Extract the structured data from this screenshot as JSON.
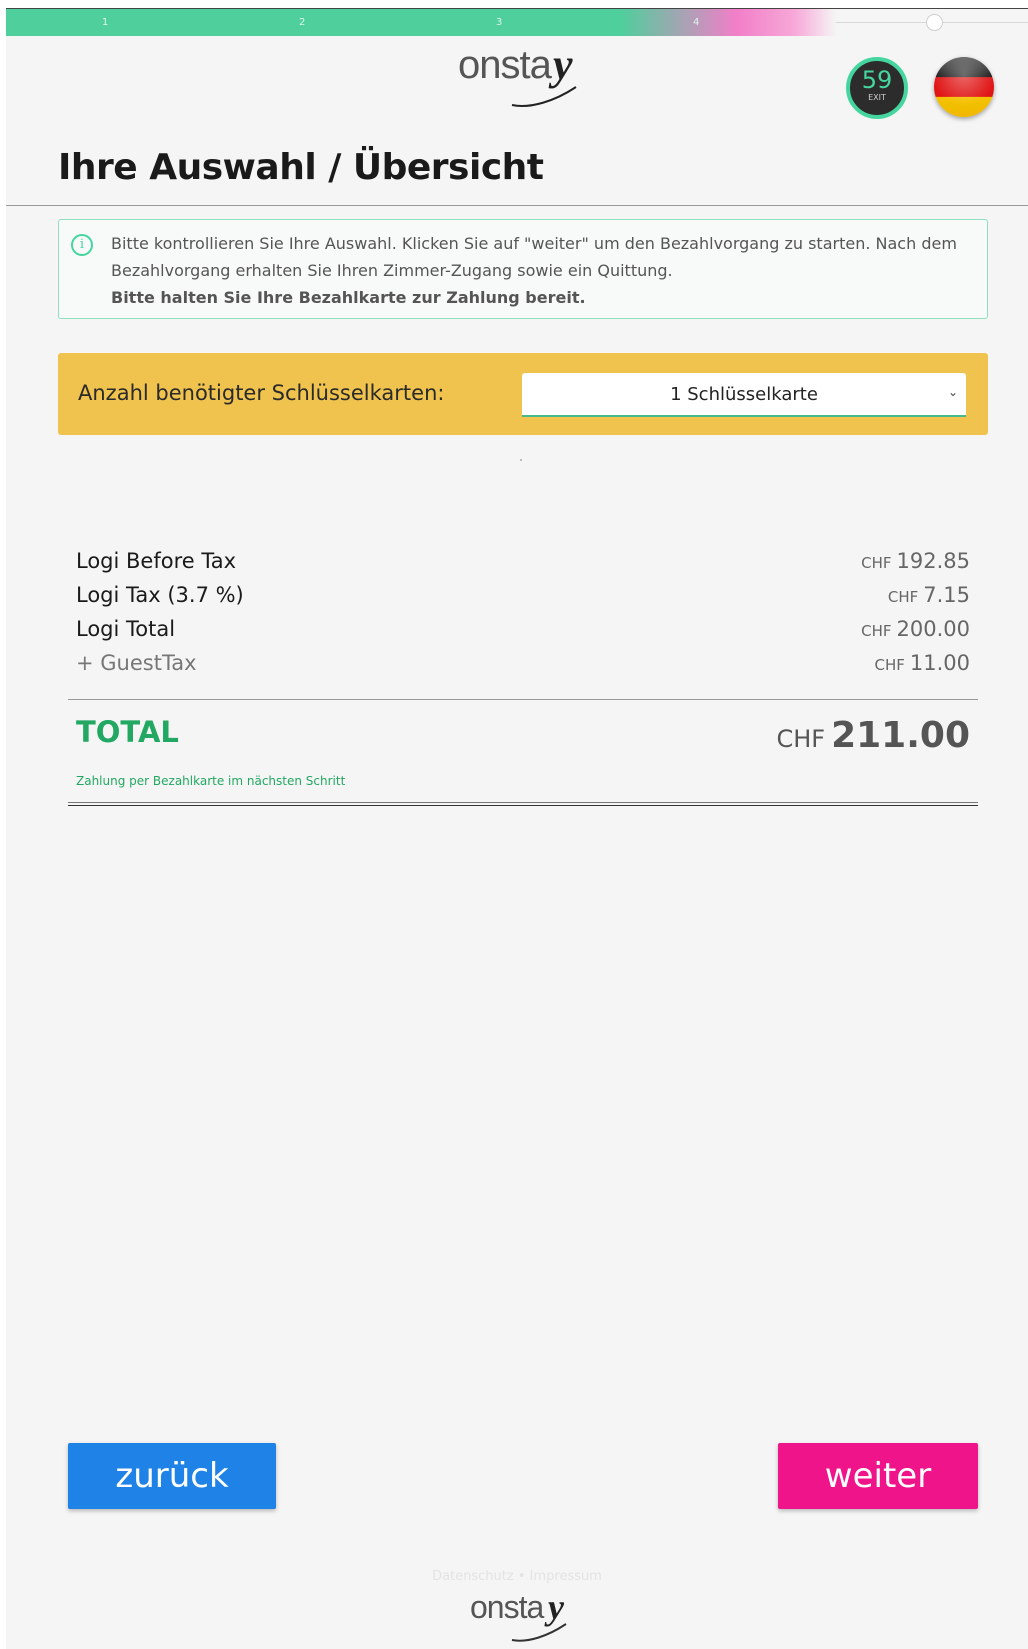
{
  "progress": {
    "steps": [
      "1",
      "2",
      "3",
      "4"
    ],
    "completed_fraction": 0.81
  },
  "header": {
    "logo_text": "onsta",
    "logo_mark": "y",
    "timer": {
      "seconds": "59",
      "label": "EXIT"
    },
    "language_flag": "germany-flag-icon"
  },
  "page_title": "Ihre Auswahl / Übersicht",
  "info": {
    "icon": "info-icon",
    "line1": "Bitte kontrollieren Sie Ihre Auswahl. Klicken Sie auf \"weiter\" um den Bezahlvorgang zu starten. Nach dem Bezahlvorgang erhalten Sie Ihren Zimmer-Zugang sowie ein Quittung.",
    "line2": "Bitte halten Sie Ihre Bezahlkarte zur Zahlung bereit."
  },
  "keycards": {
    "label": "Anzahl benötigter Schlüsselkarten:",
    "selected": "1 Schlüsselkarte"
  },
  "prices": [
    {
      "label": "Logi Before Tax",
      "currency": "CHF",
      "amount": "192.85"
    },
    {
      "label": "Logi Tax (3.7 %)",
      "currency": "CHF",
      "amount": "7.15"
    },
    {
      "label": "Logi Total",
      "currency": "CHF",
      "amount": "200.00"
    },
    {
      "label": "+ GuestTax",
      "currency": "CHF",
      "amount": "11.00"
    }
  ],
  "total": {
    "label": "TOTAL",
    "currency": "CHF",
    "amount": "211.00",
    "note": "Zahlung per Bezahlkarte im nächsten Schritt"
  },
  "buttons": {
    "back": "zurück",
    "next": "weiter"
  },
  "footer": {
    "links": "Datenschutz • Impressum",
    "logo_text": "onsta",
    "logo_mark": "y"
  },
  "colors": {
    "accent_green": "#45d69f",
    "total_green": "#22a862",
    "keycard_yellow": "#efc34e",
    "back_blue": "#1e82e6",
    "next_pink": "#f0148a"
  }
}
